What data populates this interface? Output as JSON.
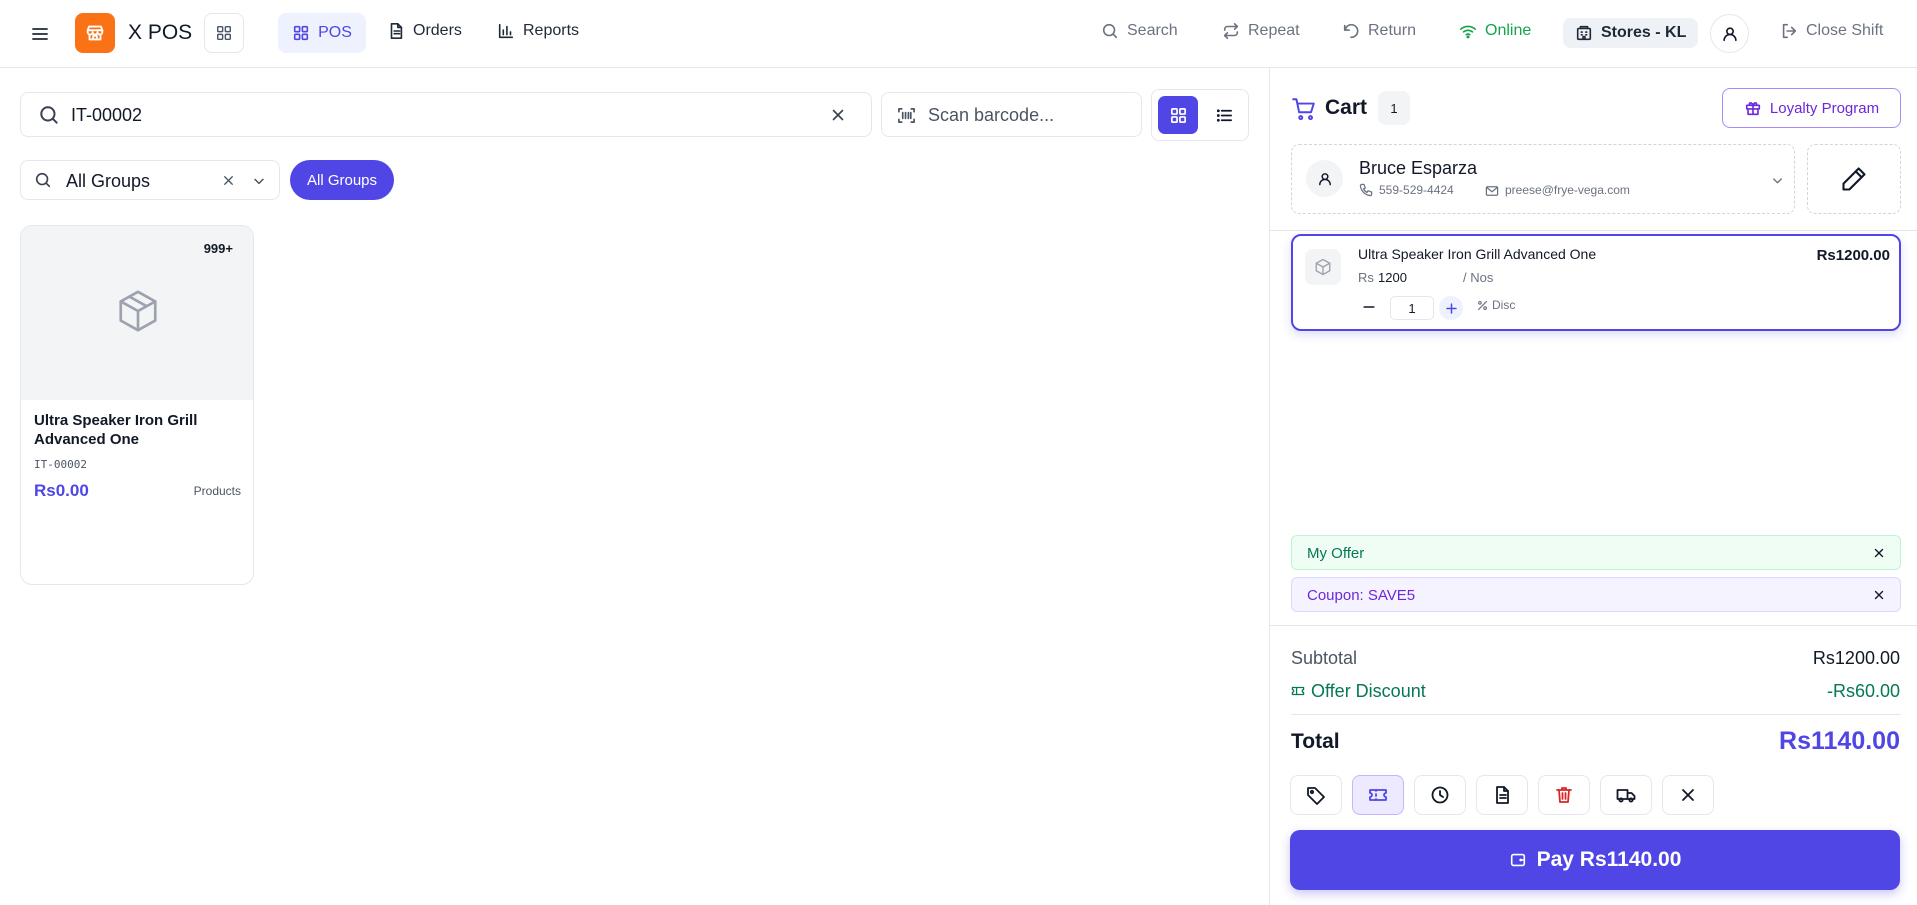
{
  "app": {
    "title": "X POS"
  },
  "nav": {
    "pos": "POS",
    "orders": "Orders",
    "reports": "Reports"
  },
  "topbar": {
    "search": "Search",
    "repeat": "Repeat",
    "return": "Return",
    "online": "Online",
    "store": "Stores - KL",
    "close_shift": "Close Shift"
  },
  "colors": {
    "accent": "#4f46e5",
    "brand": "#f97316",
    "online": "#16a34a",
    "danger": "#dc2626",
    "offer_green": "#047857"
  },
  "search": {
    "value": "IT-00002",
    "barcode_placeholder": "Scan barcode..."
  },
  "filter": {
    "group_value": "All Groups",
    "chip": "All Groups"
  },
  "products": [
    {
      "badge": "999+",
      "name": "Ultra Speaker Iron Grill Advanced One",
      "code": "IT-00002",
      "price": "Rs0.00",
      "group": "Products"
    }
  ],
  "cart": {
    "title": "Cart",
    "count": "1",
    "loyalty": "Loyalty Program",
    "customer": {
      "name": "Bruce Esparza",
      "phone": "559-529-4424",
      "email": "preese@frye-vega.com"
    },
    "items": [
      {
        "name": "Ultra Speaker Iron Grill Advanced One",
        "currency": "Rs",
        "rate": "1200",
        "uom": "/ Nos",
        "qty": "1",
        "disc": "Disc",
        "amount": "Rs1200.00"
      }
    ],
    "offers": [
      {
        "label": "My Offer",
        "type": "offer"
      },
      {
        "label": "Coupon: SAVE5",
        "type": "coupon"
      }
    ],
    "subtotal_label": "Subtotal",
    "subtotal": "Rs1200.00",
    "discount_label": "Offer Discount",
    "discount": "-Rs60.00",
    "total_label": "Total",
    "total": "Rs1140.00",
    "pay_label": "Pay Rs1140.00"
  }
}
